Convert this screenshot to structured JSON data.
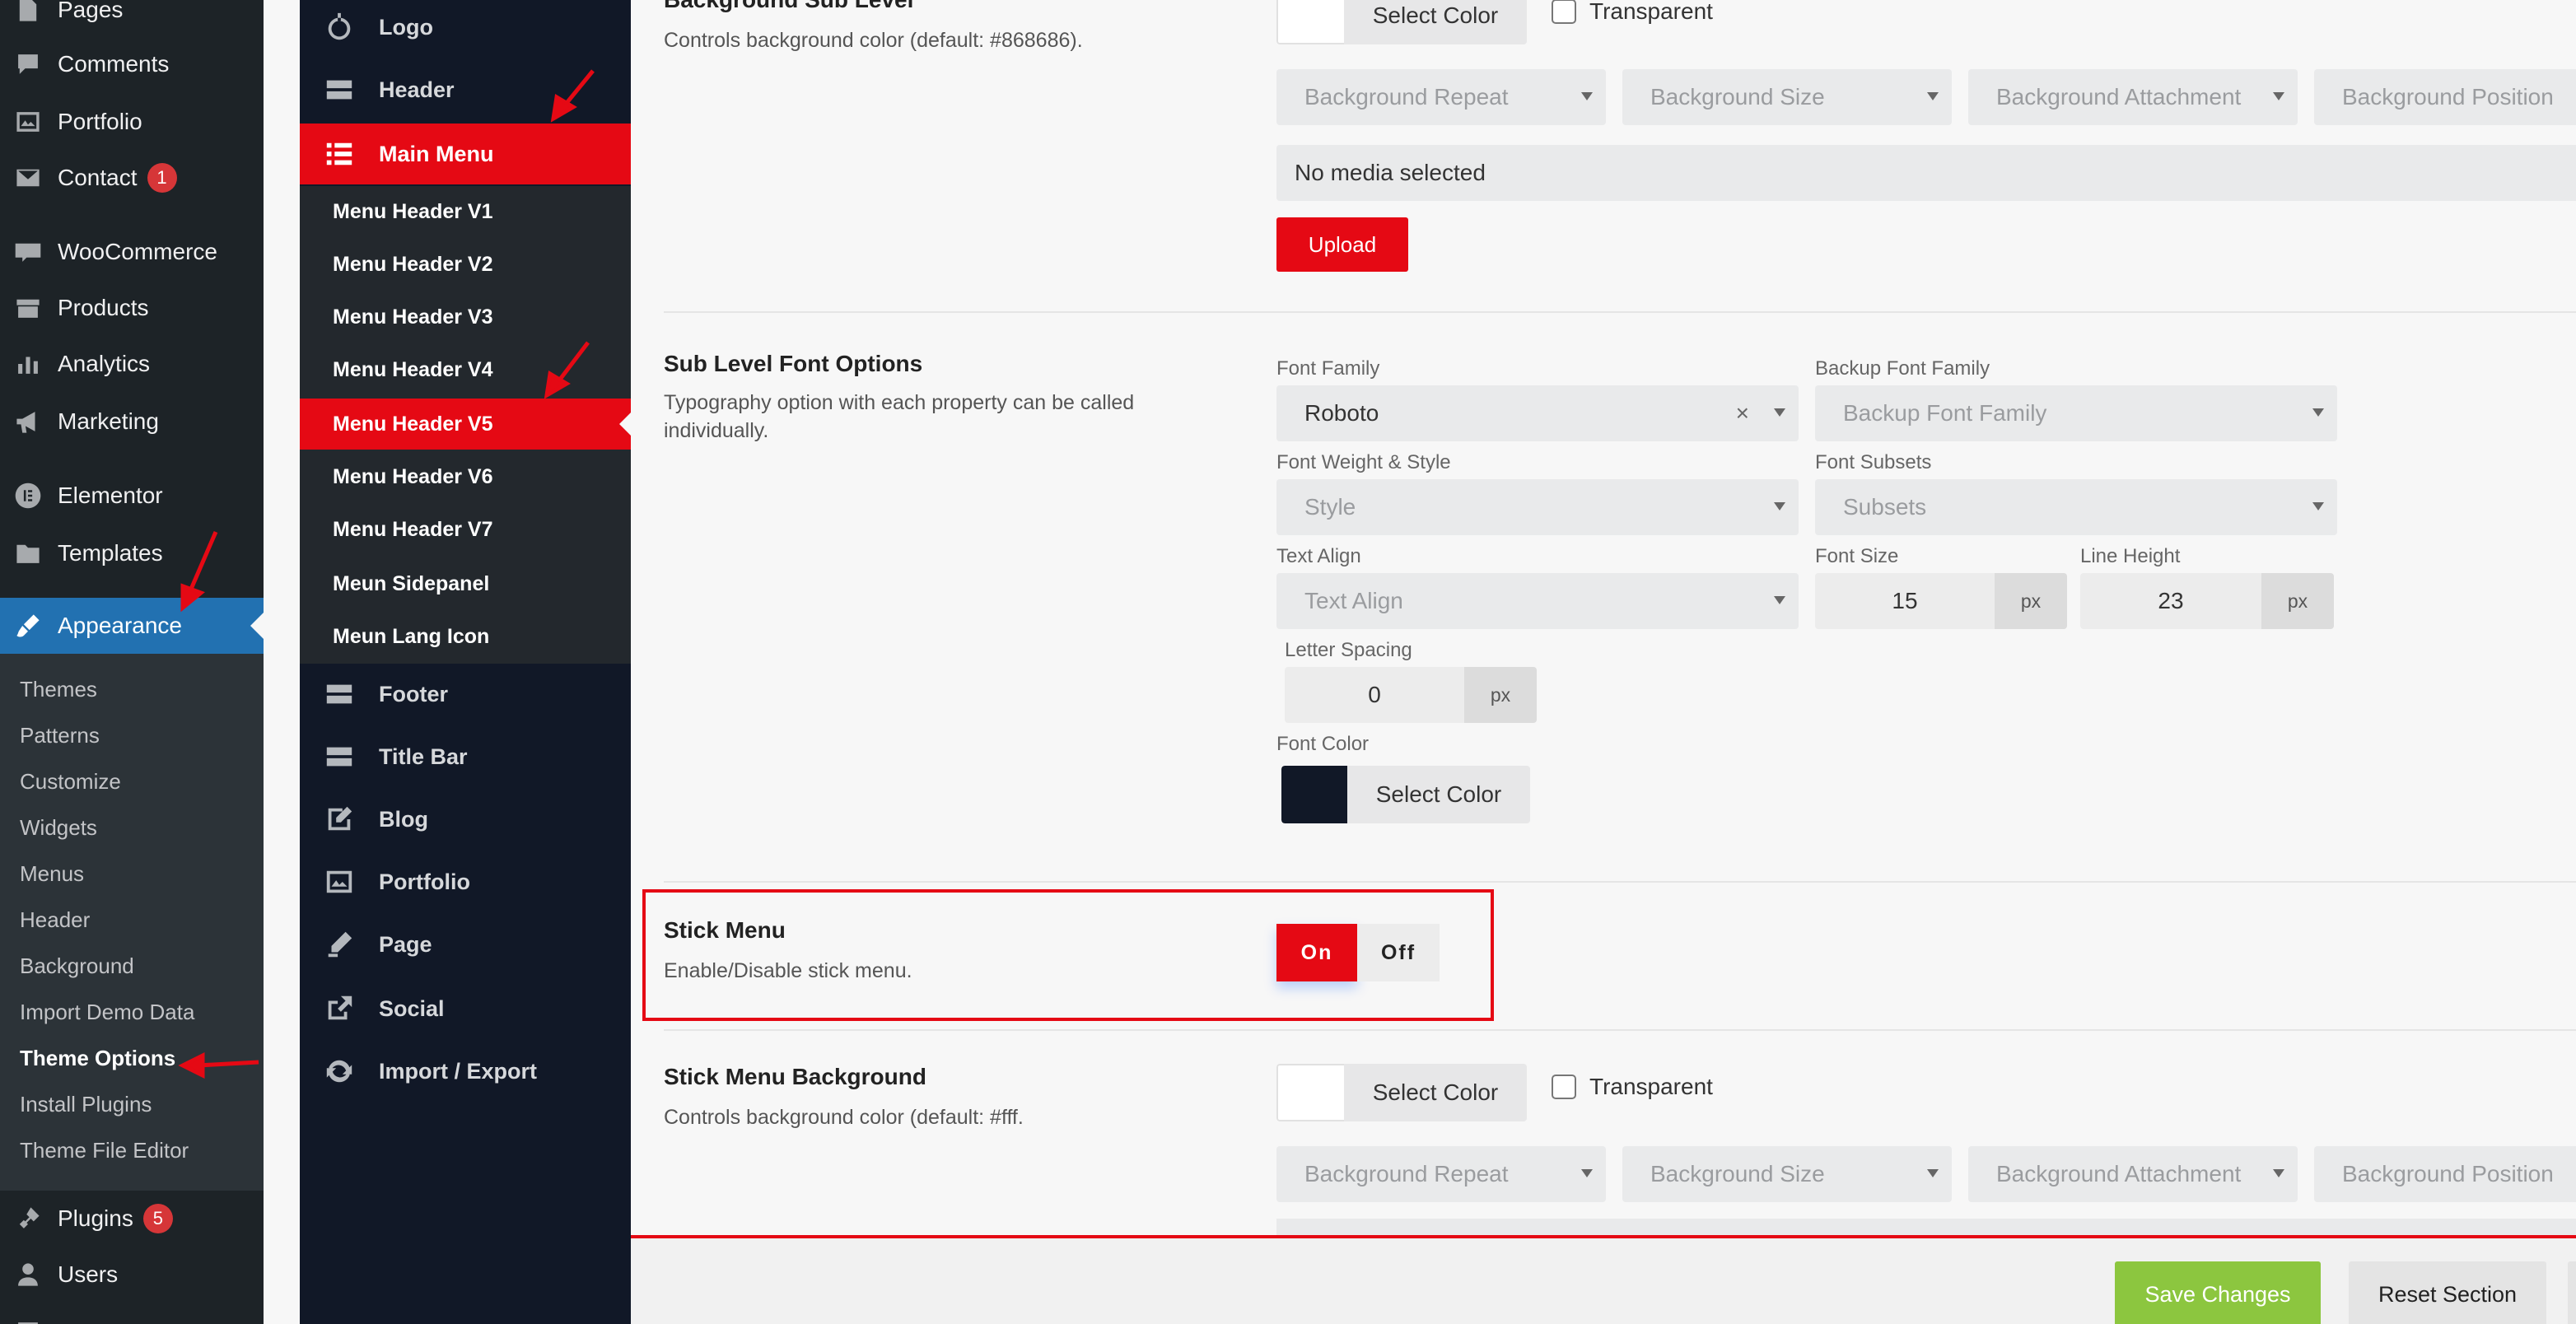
{
  "wp_sidebar": {
    "items": [
      {
        "label": "Pages",
        "icon": "pages-icon"
      },
      {
        "label": "Comments",
        "icon": "comments-icon"
      },
      {
        "label": "Portfolio",
        "icon": "portfolio-icon"
      },
      {
        "label": "Contact",
        "icon": "contact-icon",
        "badge": "1"
      },
      {
        "label": "WooCommerce",
        "icon": "woocommerce-icon"
      },
      {
        "label": "Products",
        "icon": "products-icon"
      },
      {
        "label": "Analytics",
        "icon": "analytics-icon"
      },
      {
        "label": "Marketing",
        "icon": "marketing-icon"
      },
      {
        "label": "Elementor",
        "icon": "elementor-icon"
      },
      {
        "label": "Templates",
        "icon": "templates-icon"
      },
      {
        "label": "Appearance",
        "icon": "appearance-icon"
      },
      {
        "label": "Plugins",
        "icon": "plugins-icon",
        "badge": "5"
      },
      {
        "label": "Users",
        "icon": "users-icon"
      }
    ],
    "submenu": [
      "Themes",
      "Patterns",
      "Customize",
      "Widgets",
      "Menus",
      "Header",
      "Background",
      "Import Demo Data",
      "Theme Options",
      "Install Plugins",
      "Theme File Editor"
    ]
  },
  "theme_nav": {
    "items": [
      {
        "label": "Logo",
        "icon": "logo-icon"
      },
      {
        "label": "Header",
        "icon": "header-icon"
      },
      {
        "label": "Main Menu",
        "icon": "list-icon"
      },
      {
        "label": "Footer",
        "icon": "footer-icon"
      },
      {
        "label": "Title Bar",
        "icon": "title-bar-icon"
      },
      {
        "label": "Blog",
        "icon": "blog-icon"
      },
      {
        "label": "Portfolio",
        "icon": "portfolio-icon"
      },
      {
        "label": "Page",
        "icon": "page-icon"
      },
      {
        "label": "Social",
        "icon": "social-icon"
      },
      {
        "label": "Import / Export",
        "icon": "refresh-icon"
      }
    ],
    "submenu": [
      "Menu Header V1",
      "Menu Header V2",
      "Menu Header V3",
      "Menu Header V4",
      "Menu Header V5",
      "Menu Header V6",
      "Menu Header V7",
      "Meun Sidepanel",
      "Meun Lang Icon"
    ]
  },
  "main": {
    "bg_sub_level": {
      "title": "Background Sub Level",
      "desc": "Controls background color (default: #868686).",
      "select_color": "Select Color",
      "transparent": "Transparent",
      "repeat": "Background Repeat",
      "size": "Background Size",
      "attachment": "Background Attachment",
      "position": "Background Position",
      "media": "No media selected",
      "upload": "Upload"
    },
    "sub_font": {
      "title": "Sub Level Font Options",
      "desc": "Typography option with each property can be called individually.",
      "font_family_label": "Font Family",
      "font_family_value": "Roboto",
      "clear": "×",
      "backup_label": "Backup Font Family",
      "backup_placeholder": "Backup Font Family",
      "weight_label": "Font Weight & Style",
      "weight_placeholder": "Style",
      "subsets_label": "Font Subsets",
      "subsets_placeholder": "Subsets",
      "align_label": "Text Align",
      "align_placeholder": "Text Align",
      "size_label": "Font Size",
      "size_value": "15",
      "line_label": "Line Height",
      "line_value": "23",
      "spacing_label": "Letter Spacing",
      "spacing_value": "0",
      "unit": "px",
      "color_label": "Font Color",
      "color_value": "#111827",
      "select_color": "Select Color"
    },
    "stick_menu": {
      "title": "Stick Menu",
      "desc": "Enable/Disable stick menu.",
      "on": "On",
      "off": "Off"
    },
    "stick_bg": {
      "title": "Stick Menu Background",
      "desc": "Controls background color (default: #fff.",
      "select_color": "Select Color",
      "transparent": "Transparent",
      "repeat": "Background Repeat",
      "size": "Background Size",
      "attachment": "Background Attachment",
      "position": "Background Position"
    }
  },
  "footer": {
    "save": "Save Changes",
    "reset": "Reset Section"
  },
  "colors": {
    "accent_red": "#e50914",
    "wp_blue": "#2271b1",
    "save_green": "#8cc63f"
  }
}
